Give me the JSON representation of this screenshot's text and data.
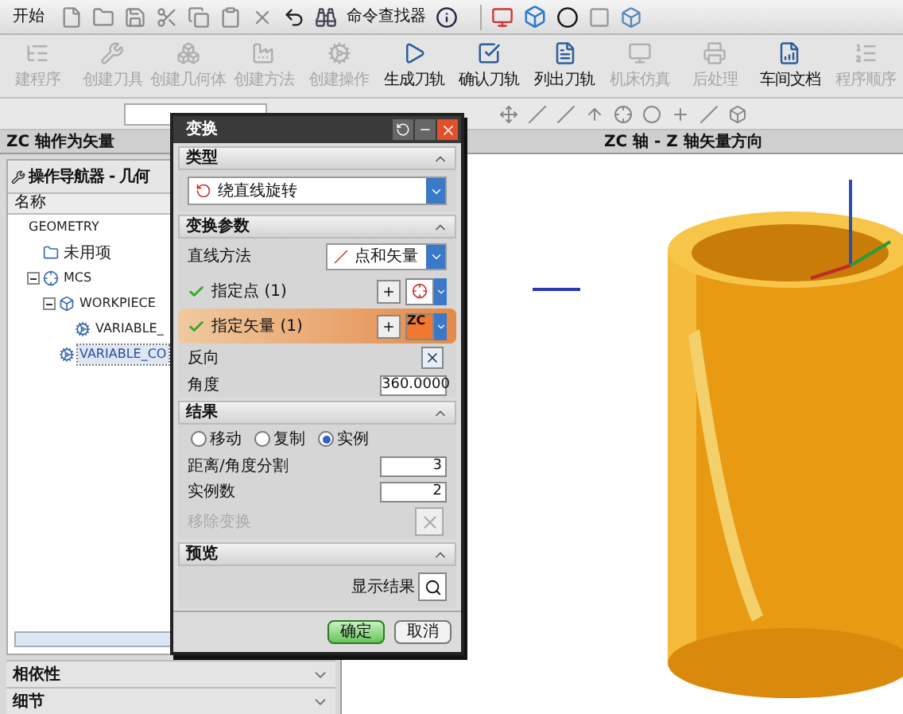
{
  "toolbar": {
    "start_menu": "开始",
    "command_finder": "命令查找器"
  },
  "ribbon": [
    {
      "label": "建程序",
      "disabled": true
    },
    {
      "label": "创建刀具",
      "disabled": true
    },
    {
      "label": "创建几何体",
      "disabled": true
    },
    {
      "label": "创建方法",
      "disabled": true
    },
    {
      "label": "创建操作",
      "disabled": true
    },
    {
      "label": "生成刀轨",
      "disabled": false
    },
    {
      "label": "确认刀轨",
      "disabled": false
    },
    {
      "label": "列出刀轨",
      "disabled": false
    },
    {
      "label": "机床仿真",
      "disabled": true
    },
    {
      "label": "后处理",
      "disabled": true
    },
    {
      "label": "车间文档",
      "disabled": false
    },
    {
      "label": "程序顺序",
      "disabled": true
    }
  ],
  "cue_line": {
    "left": "ZC 轴作为矢量",
    "right": "ZC 轴 - Z 轴矢量方向"
  },
  "navigator": {
    "title": "操作导航器 - 几何",
    "column": "名称",
    "tree": [
      {
        "label": "GEOMETRY",
        "selected": false,
        "children": [
          {
            "label": "未用项",
            "kind": "folder",
            "selected": false
          },
          {
            "label": "MCS",
            "kind": "mcs",
            "selected": false,
            "expanded": true,
            "children": [
              {
                "label": "WORKPIECE",
                "kind": "workpiece",
                "selected": false,
                "expanded": true,
                "children": [
                  {
                    "label": "VARIABLE_",
                    "kind": "operation",
                    "selected": false
                  }
                ]
              },
              {
                "label": "VARIABLE_CO",
                "kind": "operation",
                "selected": true
              }
            ]
          }
        ]
      }
    ]
  },
  "panels": [
    {
      "label": "相依性",
      "expanded": false
    },
    {
      "label": "细节",
      "expanded": false
    }
  ],
  "dialog": {
    "title": "变换",
    "sections": [
      {
        "header": "类型",
        "expanded": true,
        "rows": [
          {
            "kind": "dropdown",
            "value": "绕直线旋转"
          }
        ]
      },
      {
        "header": "变换参数",
        "expanded": true,
        "rows": [
          {
            "kind": "method",
            "label": "直线方法",
            "value": "点和矢量"
          },
          {
            "kind": "point",
            "label": "指定点",
            "count": "(1)",
            "checked": true,
            "selected": false
          },
          {
            "kind": "vector",
            "label": "指定矢量",
            "count": "(1)",
            "checked": true,
            "selected": true,
            "vector_label": "ZC"
          },
          {
            "kind": "reverse",
            "label": "反向"
          },
          {
            "kind": "number",
            "label": "角度",
            "value": "360.0000"
          }
        ]
      },
      {
        "header": "结果",
        "expanded": true,
        "rows": [
          {
            "kind": "radios",
            "options": [
              {
                "label": "移动",
                "selected": false
              },
              {
                "label": "复制",
                "selected": false
              },
              {
                "label": "实例",
                "selected": true
              }
            ]
          },
          {
            "kind": "number",
            "label": "距离/角度分割",
            "value": "3"
          },
          {
            "kind": "number",
            "label": "实例数",
            "value": "2"
          },
          {
            "kind": "action",
            "label": "移除变换",
            "disabled": true
          }
        ]
      },
      {
        "header": "预览",
        "expanded": true,
        "rows": [
          {
            "kind": "preview",
            "label": "显示结果"
          }
        ]
      }
    ],
    "buttons": [
      {
        "label": "确定",
        "default": true
      },
      {
        "label": "取消",
        "default": false
      }
    ]
  }
}
